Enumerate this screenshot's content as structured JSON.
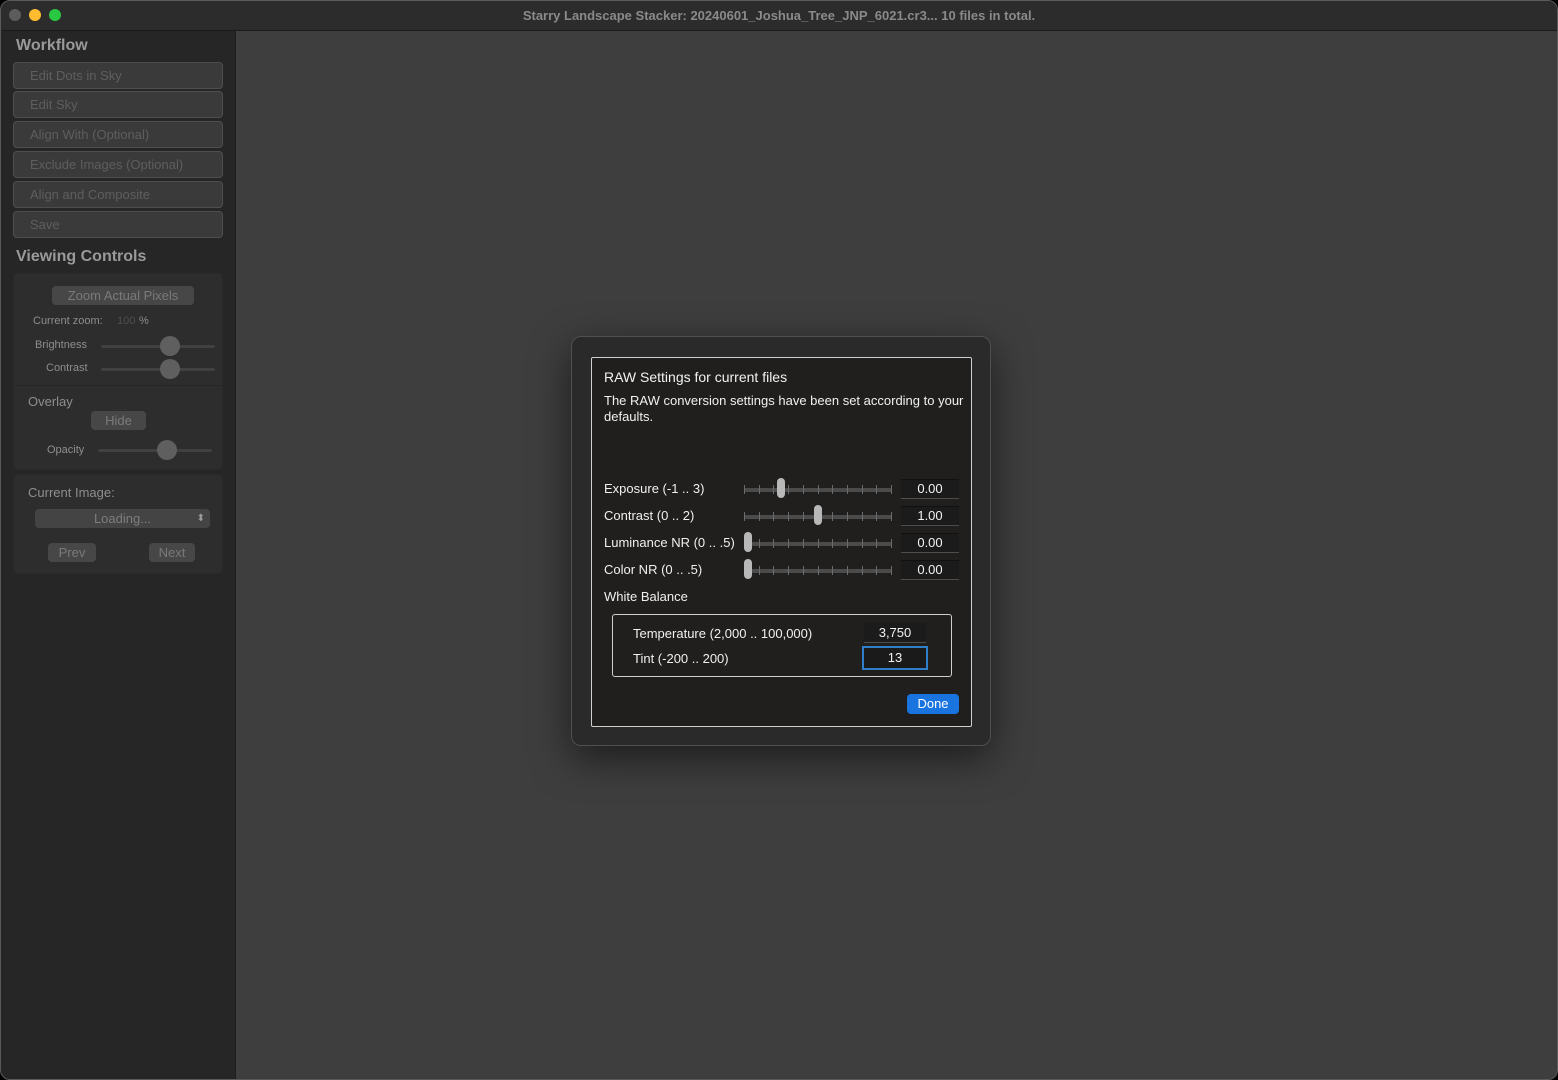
{
  "window": {
    "title": "Starry Landscape Stacker: 20240601_Joshua_Tree_JNP_6021.cr3...  10 files in total."
  },
  "sidebar": {
    "workflow_title": "Workflow",
    "workflow_buttons": [
      "Edit Dots in Sky",
      "Edit Sky",
      "Align With (Optional)",
      "Exclude Images (Optional)",
      "Align and Composite",
      "Save"
    ],
    "viewing_title": "Viewing Controls",
    "zoom_button": "Zoom Actual Pixels",
    "current_zoom_label": "Current zoom:",
    "current_zoom_value": "100",
    "current_zoom_unit": "%",
    "brightness_label": "Brightness",
    "brightness_level": 0.5,
    "contrast_label": "Contrast",
    "contrast_level": 0.5,
    "overlay_label": "Overlay",
    "overlay_button": "Hide",
    "opacity_label": "Opacity",
    "opacity_level": 0.5,
    "current_image_label": "Current Image:",
    "current_image_select": "Loading...",
    "prev_button": "Prev",
    "next_button": "Next"
  },
  "dialog": {
    "title": "RAW Settings for current files",
    "description": "The RAW conversion settings have been set according to your defaults.",
    "sliders": [
      {
        "label": "Exposure (-1 .. 3)",
        "value": "0.00",
        "min": -1,
        "max": 3,
        "current": 0.0
      },
      {
        "label": "Contrast (0 .. 2)",
        "value": "1.00",
        "min": 0,
        "max": 2,
        "current": 1.0
      },
      {
        "label": "Luminance NR (0 .. .5)",
        "value": "0.00",
        "min": 0,
        "max": 0.5,
        "current": 0.0
      },
      {
        "label": "Color NR (0 .. .5)",
        "value": "0.00",
        "min": 0,
        "max": 0.5,
        "current": 0.0
      }
    ],
    "white_balance_label": "White Balance",
    "temperature_label": "Temperature (2,000 .. 100,000)",
    "temperature_value": "3,750",
    "tint_label": "Tint (-200 .. 200)",
    "tint_value": "13",
    "done_button": "Done"
  },
  "colors": {
    "accent": "#1a74e0",
    "focus_ring": "#2f7fc8",
    "minimize": "#febc2e",
    "maximize": "#28c840"
  }
}
